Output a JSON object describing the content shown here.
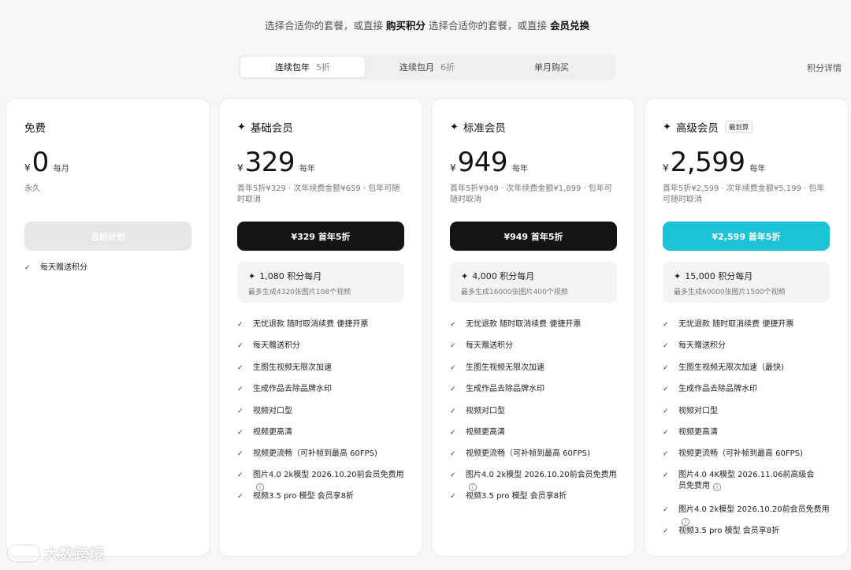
{
  "header": {
    "text1": "选择合适你的套餐，或直接",
    "link1": "购买积分",
    "text2": "选择合适你的套餐，或直接",
    "link2": "会员兑换"
  },
  "tabs": [
    {
      "label": "连续包年",
      "discount": "5折"
    },
    {
      "label": "连续包月",
      "discount": "6折"
    },
    {
      "label": "单月购买",
      "discount": ""
    }
  ],
  "points_details": "积分详情",
  "plans": [
    {
      "name": "免费",
      "tag": "",
      "currency": "¥",
      "amount": "0",
      "period": "每月",
      "note": "永久",
      "cta": "当前计划",
      "features": [
        "每天赠送积分"
      ]
    },
    {
      "name": "基础会员",
      "tag": "",
      "currency": "¥",
      "amount": "329",
      "period": "每年",
      "note": "首年5折¥329 · 次年续费金额¥659 · 包年可随时取消",
      "cta": "¥329 首年5折",
      "credits": "1,080 积分每月",
      "credits_sub": "最多生成4320张图片108个视频",
      "features": [
        "无忧退款 随时取消续费 便捷开票",
        "每天赠送积分",
        "生图生视频无限次加速",
        "生成作品去除品牌水印",
        "视频对口型",
        "视频更高清",
        "视频更流畅（可补帧到最高 60FPS)",
        "图片4.0 2k模型 2026.10.20前会员免费用",
        "视频3.5 pro 模型 会员享8折"
      ]
    },
    {
      "name": "标准会员",
      "tag": "",
      "currency": "¥",
      "amount": "949",
      "period": "每年",
      "note": "首年5折¥949 · 次年续费金额¥1,899 · 包年可随时取消",
      "cta": "¥949 首年5折",
      "credits": "4,000 积分每月",
      "credits_sub": "最多生成16000张图片400个视频",
      "features": [
        "无忧退款 随时取消续费 便捷开票",
        "每天赠送积分",
        "生图生视频无限次加速",
        "生成作品去除品牌水印",
        "视频对口型",
        "视频更高清",
        "视频更流畅（可补帧到最高 60FPS)",
        "图片4.0 2k模型 2026.10.20前会员免费用",
        "视频3.5 pro 模型 会员享8折"
      ]
    },
    {
      "name": "高级会员",
      "tag": "最划算",
      "currency": "¥",
      "amount": "2,599",
      "period": "每年",
      "note": "首年5折¥2,599 · 次年续费金额¥5,199 · 包年可随时取消",
      "cta": "¥2,599 首年5折",
      "credits": "15,000 积分每月",
      "credits_sub": "最多生成60000张图片1500个视频",
      "features": [
        "无忧退款 随时取消续费 便捷开票",
        "每天赠送积分",
        "生图生视频无限次加速（最快)",
        "生成作品去除品牌水印",
        "视频对口型",
        "视频更高清",
        "视频更流畅（可补帧到最高 60FPS)",
        "图片4.0 4K模型 2026.11.06前高级会员免费用",
        "图片4.0 2k模型 2026.10.20前会员免费用",
        "视频3.5 pro 模型 会员享8折"
      ]
    }
  ],
  "watermark": "大数跨境"
}
